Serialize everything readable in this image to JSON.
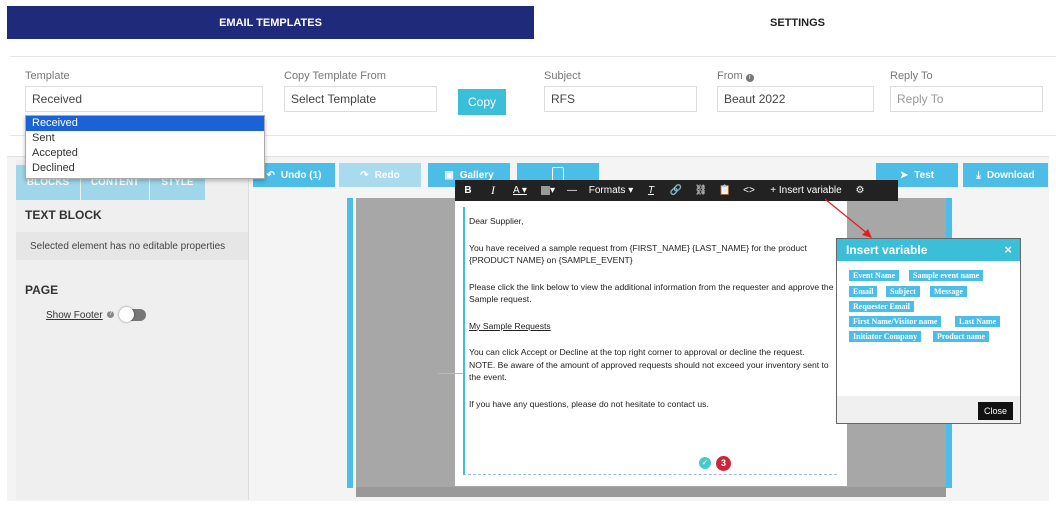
{
  "tabs": {
    "email_templates": "EMAIL TEMPLATES",
    "settings": "SETTINGS"
  },
  "form": {
    "template_label": "Template",
    "template_value": "Received",
    "copy_from_label": "Copy Template From",
    "copy_from_value": "Select Template",
    "copy_button": "Copy",
    "subject_label": "Subject",
    "subject_value": "RFS",
    "from_label": "From",
    "from_value": "Beaut 2022",
    "reply_to_label": "Reply To",
    "reply_to_placeholder": "Reply To"
  },
  "dropdown": {
    "options": [
      "Received",
      "Sent",
      "Accepted",
      "Declined"
    ],
    "selected": "Received"
  },
  "left_panel": {
    "tabs": [
      "BLOCKS",
      "CONTENT",
      "STYLE"
    ],
    "text_block_title": "TEXT BLOCK",
    "note": "Selected element has no editable properties",
    "page_title": "PAGE",
    "show_footer": "Show Footer"
  },
  "toolbar": {
    "undo": "Undo (1)",
    "redo": "Redo",
    "gallery": "Gallery",
    "test": "Test",
    "download": "Download"
  },
  "rte": {
    "formats": "Formats",
    "insert_variable": "+ Insert variable"
  },
  "email": {
    "greeting": "Dear Supplier,",
    "p1": "You have received a sample request from {FIRST_NAME} {LAST_NAME} for the product {PRODUCT NAME} on {SAMPLE_EVENT}",
    "p2": "Please click the link below to view the additional information from the requester and approve the Sample request.",
    "link": "My Sample Requests",
    "p3a": "You can click Accept or Decline at the top right corner to approval or decline the request.",
    "p3b": "NOTE. Be aware of the amount of approved requests should not exceed your inventory sent to the event.",
    "p4": "If you have any questions, please do not hesitate to contact us.",
    "badge_count": "3"
  },
  "insert_variable": {
    "title": "Insert variable",
    "close_x": "×",
    "chips": [
      "Event Name",
      "Sample event name",
      "Email",
      "Subject",
      "Message",
      "Requester Email",
      "First Name/Visitor name",
      "Last Name",
      "Initiator Company",
      "Product name"
    ],
    "close_button": "Close"
  }
}
